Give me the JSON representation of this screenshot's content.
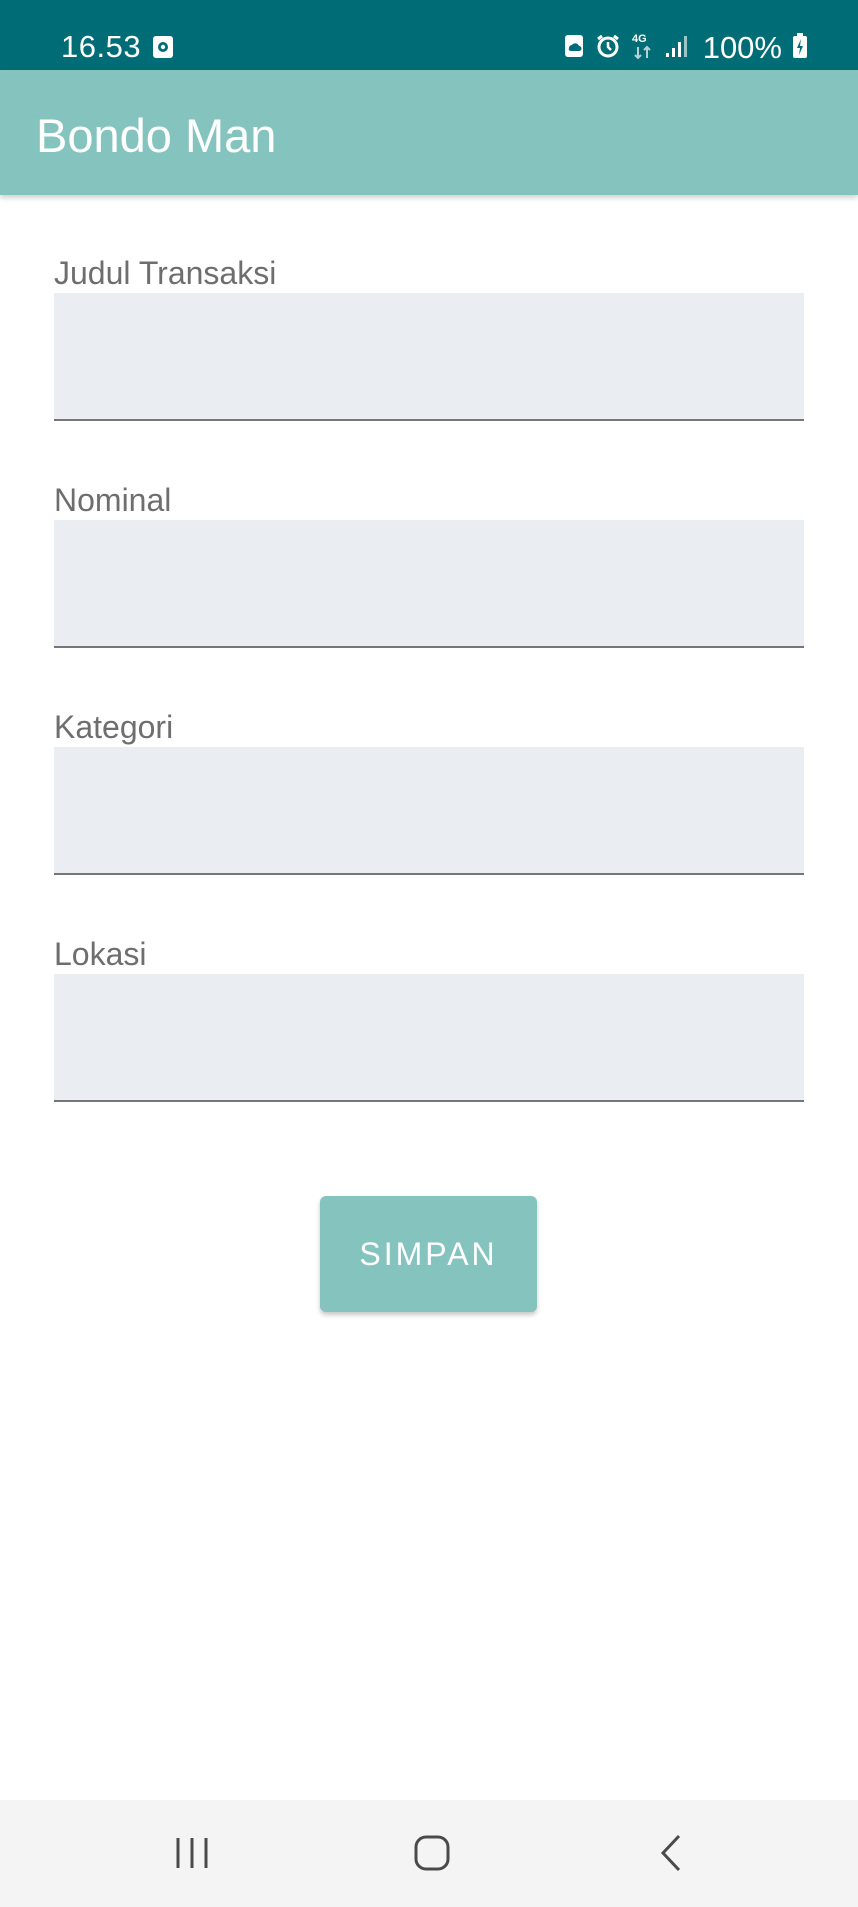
{
  "status_bar": {
    "time": "16.53",
    "battery": "100%",
    "network": "4G",
    "icons": [
      "screen-record-icon",
      "cloud-sync-icon",
      "alarm-icon",
      "network-4g-icon",
      "signal-icon",
      "battery-charging-icon"
    ]
  },
  "app_bar": {
    "title": "Bondo Man",
    "color": "#85C4BE"
  },
  "form": {
    "fields": [
      {
        "label": "Judul Transaksi",
        "value": "",
        "placeholder": ""
      },
      {
        "label": "Nominal",
        "value": "",
        "placeholder": ""
      },
      {
        "label": "Kategori",
        "value": "",
        "placeholder": ""
      },
      {
        "label": "Lokasi",
        "value": "",
        "placeholder": ""
      }
    ],
    "save_label": "SIMPAN"
  },
  "nav_bar": {
    "items": [
      "recent-apps-icon",
      "home-icon",
      "back-icon"
    ]
  },
  "colors": {
    "status_bar": "#006C75",
    "accent": "#85C4BE",
    "input_bg": "#EAEDF1",
    "label": "#6E6E6E"
  }
}
